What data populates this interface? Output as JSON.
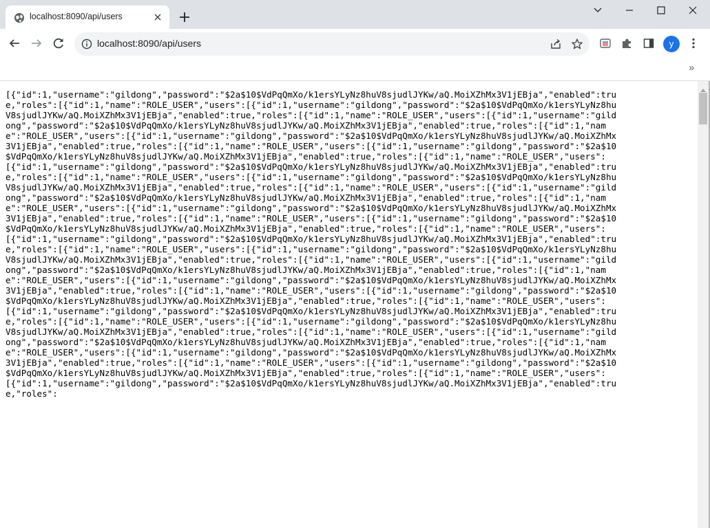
{
  "tab": {
    "title": "localhost:8090/api/users"
  },
  "toolbar": {
    "url": "localhost:8090/api/users",
    "avatar_letter": "y"
  },
  "bookmarks": {
    "more": "»"
  },
  "content": {
    "json_text": "[{\"id\":1,\"username\":\"gildong\",\"password\":\"$2a$10$VdPqQmXo/k1ersYLyNz8huV8sjudlJYKw/aQ.MoiXZhMx3V1jEBja\",\"enabled\":true,\"roles\":[{\"id\":1,\"name\":\"ROLE_USER\",\"users\":[{\"id\":1,\"username\":\"gildong\",\"password\":\"$2a$10$VdPqQmXo/k1ersYLyNz8huV8sjudlJYKw/aQ.MoiXZhMx3V1jEBja\",\"enabled\":true,\"roles\":[{\"id\":1,\"name\":\"ROLE_USER\",\"users\":[{\"id\":1,\"username\":\"gildong\",\"password\":\"$2a$10$VdPqQmXo/k1ersYLyNz8huV8sjudlJYKw/aQ.MoiXZhMx3V1jEBja\",\"enabled\":true,\"roles\":[{\"id\":1,\"name\":\"ROLE_USER\",\"users\":[{\"id\":1,\"username\":\"gildong\",\"password\":\"$2a$10$VdPqQmXo/k1ersYLyNz8huV8sjudlJYKw/aQ.MoiXZhMx3V1jEBja\",\"enabled\":true,\"roles\":[{\"id\":1,\"name\":\"ROLE_USER\",\"users\":[{\"id\":1,\"username\":\"gildong\",\"password\":\"$2a$10$VdPqQmXo/k1ersYLyNz8huV8sjudlJYKw/aQ.MoiXZhMx3V1jEBja\",\"enabled\":true,\"roles\":[{\"id\":1,\"name\":\"ROLE_USER\",\"users\":[{\"id\":1,\"username\":\"gildong\",\"password\":\"$2a$10$VdPqQmXo/k1ersYLyNz8huV8sjudlJYKw/aQ.MoiXZhMx3V1jEBja\",\"enabled\":true,\"roles\":[{\"id\":1,\"name\":\"ROLE_USER\",\"users\":[{\"id\":1,\"username\":\"gildong\",\"password\":\"$2a$10$VdPqQmXo/k1ersYLyNz8huV8sjudlJYKw/aQ.MoiXZhMx3V1jEBja\",\"enabled\":true,\"roles\":[{\"id\":1,\"name\":\"ROLE_USER\",\"users\":[{\"id\":1,\"username\":\"gildong\",\"password\":\"$2a$10$VdPqQmXo/k1ersYLyNz8huV8sjudlJYKw/aQ.MoiXZhMx3V1jEBja\",\"enabled\":true,\"roles\":[{\"id\":1,\"name\":\"ROLE_USER\",\"users\":[{\"id\":1,\"username\":\"gildong\",\"password\":\"$2a$10$VdPqQmXo/k1ersYLyNz8huV8sjudlJYKw/aQ.MoiXZhMx3V1jEBja\",\"enabled\":true,\"roles\":[{\"id\":1,\"name\":\"ROLE_USER\",\"users\":[{\"id\":1,\"username\":\"gildong\",\"password\":\"$2a$10$VdPqQmXo/k1ersYLyNz8huV8sjudlJYKw/aQ.MoiXZhMx3V1jEBja\",\"enabled\":true,\"roles\":[{\"id\":1,\"name\":\"ROLE_USER\",\"users\":[{\"id\":1,\"username\":\"gildong\",\"password\":\"$2a$10$VdPqQmXo/k1ersYLyNz8huV8sjudlJYKw/aQ.MoiXZhMx3V1jEBja\",\"enabled\":true,\"roles\":[{\"id\":1,\"name\":\"ROLE_USER\",\"users\":[{\"id\":1,\"username\":\"gildong\",\"password\":\"$2a$10$VdPqQmXo/k1ersYLyNz8huV8sjudlJYKw/aQ.MoiXZhMx3V1jEBja\",\"enabled\":true,\"roles\":[{\"id\":1,\"name\":\"ROLE_USER\",\"users\":[{\"id\":1,\"username\":\"gildong\",\"password\":\"$2a$10$VdPqQmXo/k1ersYLyNz8huV8sjudlJYKw/aQ.MoiXZhMx3V1jEBja\",\"enabled\":true,\"roles\":[{\"id\":1,\"name\":\"ROLE_USER\",\"users\":[{\"id\":1,\"username\":\"gildong\",\"password\":\"$2a$10$VdPqQmXo/k1ersYLyNz8huV8sjudlJYKw/aQ.MoiXZhMx3V1jEBja\",\"enabled\":true,\"roles\":[{\"id\":1,\"name\":\"ROLE_USER\",\"users\":[{\"id\":1,\"username\":\"gildong\",\"password\":\"$2a$10$VdPqQmXo/k1ersYLyNz8huV8sjudlJYKw/aQ.MoiXZhMx3V1jEBja\",\"enabled\":true,\"roles\":[{\"id\":1,\"name\":\"ROLE_USER\",\"users\":[{\"id\":1,\"username\":\"gildong\",\"password\":\"$2a$10$VdPqQmXo/k1ersYLyNz8huV8sjudlJYKw/aQ.MoiXZhMx3V1jEBja\",\"enabled\":true,\"roles\":[{\"id\":1,\"name\":\"ROLE_USER\",\"users\":[{\"id\":1,\"username\":\"gildong\",\"password\":\"$2a$10$VdPqQmXo/k1ersYLyNz8huV8sjudlJYKw/aQ.MoiXZhMx3V1jEBja\",\"enabled\":true,\"roles\":[{\"id\":1,\"name\":\"ROLE_USER\",\"users\":[{\"id\":1,\"username\":\"gildong\",\"password\":\"$2a$10$VdPqQmXo/k1ersYLyNz8huV8sjudlJYKw/aQ.MoiXZhMx3V1jEBja\",\"enabled\":true,\"roles\":[{\"id\":1,\"name\":\"ROLE_USER\",\"users\":[{\"id\":1,\"username\":\"gildong\",\"password\":\"$2a$10$VdPqQmXo/k1ersYLyNz8huV8sjudlJYKw/aQ.MoiXZhMx3V1jEBja\",\"enabled\":true,\"roles\":[{\"id\":1,\"name\":\"ROLE_USER\",\"users\":[{\"id\":1,\"username\":\"gildong\",\"password\":\"$2a$10$VdPqQmXo/k1ersYLyNz8huV8sjudlJYKw/aQ.MoiXZhMx3V1jEBja\",\"enabled\":true,\"roles\":[{\"id\":1,\"name\":\"ROLE_USER\",\"users\":[{\"id\":1,\"username\":\"gildong\",\"password\":\"$2a$10$VdPqQmXo/k1ersYLyNz8huV8sjudlJYKw/aQ.MoiXZhMx3V1jEBja\",\"enabled\":true,\"roles\":"
  },
  "colors": {
    "tabstrip_bg": "#dee1e6",
    "omnibox_bg": "#f1f3f4",
    "avatar_bg": "#1a73e8",
    "icon_gray": "#5f6368"
  },
  "icons": [
    "globe-icon",
    "close-icon",
    "plus-icon",
    "chevron-down-icon",
    "minimize-icon",
    "maximize-icon",
    "window-close-icon",
    "back-arrow-icon",
    "forward-arrow-icon",
    "reload-icon",
    "info-icon",
    "share-icon",
    "star-icon",
    "extension-cast-icon",
    "puzzle-icon",
    "side-panel-icon",
    "more-vert-icon"
  ]
}
